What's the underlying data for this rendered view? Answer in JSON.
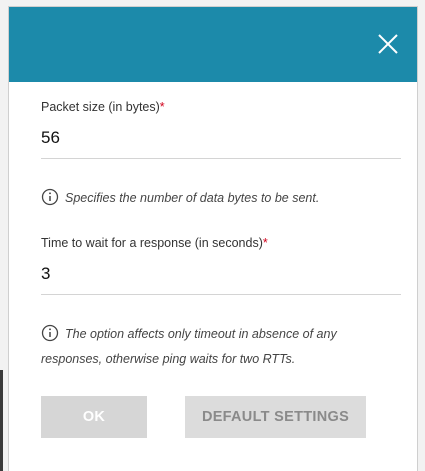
{
  "dialog": {
    "close_icon": "close-icon",
    "header_color": "#1c8aaa"
  },
  "packet_size": {
    "label": "Packet size (in bytes)",
    "required_mark": "*",
    "value": "56",
    "hint": "Specifies the number of data bytes to be sent."
  },
  "timeout": {
    "label": "Time to wait for a response (in seconds)",
    "required_mark": "*",
    "value": "3",
    "hint": "The option affects only timeout in absence of any responses, otherwise ping waits for two RTTs."
  },
  "buttons": {
    "ok_label": "OK",
    "default_label": "DEFAULT SETTINGS"
  },
  "icons": {
    "info": "info-icon"
  }
}
